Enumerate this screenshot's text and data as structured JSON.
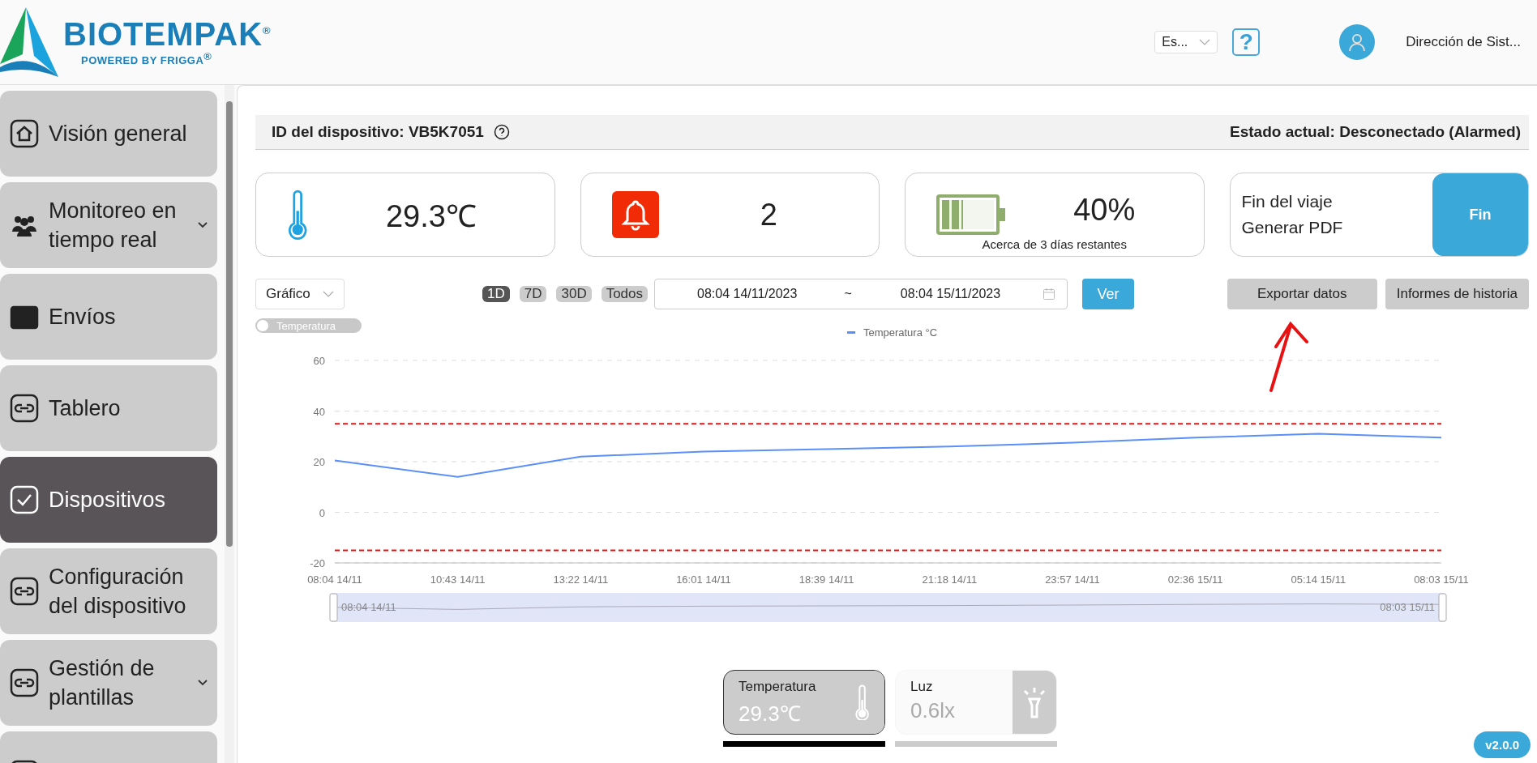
{
  "header": {
    "logo": {
      "name": "BIOTEMPAK",
      "registered": "®",
      "tagline": "POWERED BY FRIGGA",
      "tagline_registered": "®"
    },
    "language": "Es...",
    "help": "?",
    "user": "Dirección de Sist..."
  },
  "sidebar": {
    "items": [
      {
        "label": "Visión general",
        "selected": false,
        "submenu": false
      },
      {
        "label": "Monitoreo en tiempo real",
        "selected": false,
        "submenu": true
      },
      {
        "label": "Envíos",
        "selected": false,
        "submenu": false
      },
      {
        "label": "Tablero",
        "selected": false,
        "submenu": false
      },
      {
        "label": "Dispositivos",
        "selected": true,
        "submenu": false
      },
      {
        "label": "Configuración del dispositivo",
        "selected": false,
        "submenu": false
      },
      {
        "label": "Gestión de plantillas",
        "selected": false,
        "submenu": true
      },
      {
        "selected": false
      }
    ]
  },
  "device": {
    "id_label": "ID del dispositivo: VB5K7051",
    "status": "Estado actual: Desconectado (Alarmed)"
  },
  "cards": [
    {
      "kind": "temperature",
      "value": "29.3℃"
    },
    {
      "kind": "alarm",
      "value": "2"
    },
    {
      "kind": "battery",
      "value": "40%",
      "level": 0.4,
      "note": "Acerca de 3 días restantes"
    },
    {
      "kind": "trip",
      "lines": [
        "Fin del viaje",
        "Generar PDF"
      ],
      "button": "Fin"
    }
  ],
  "controls": {
    "view": "Gráfico",
    "periods": [
      {
        "label": "1D",
        "selected": true
      },
      {
        "label": "7D",
        "selected": false
      },
      {
        "label": "30D",
        "selected": false
      },
      {
        "label": "Todos",
        "selected": false
      }
    ],
    "range": {
      "start": "08:04 14/11/2023",
      "separator": "~",
      "end": "08:04 15/11/2023"
    },
    "apply": "Ver",
    "buttons": [
      "Exportar datos",
      "Informes de historia"
    ]
  },
  "toggle": {
    "label": "Temperatura",
    "on": false
  },
  "chart": {
    "chart_data": {
      "type": "line",
      "categories": [
        "08:04 14/11",
        "10:43 14/11",
        "13:22 14/11",
        "16:01 14/11",
        "18:39 14/11",
        "21:18 14/11",
        "23:57 14/11",
        "02:36 15/11",
        "05:14 15/11",
        "08:03 15/11"
      ],
      "series": [
        {
          "name": "Temperatura °C",
          "color": "#5b8ff9",
          "values": [
            20.5,
            14,
            22,
            24,
            25,
            26,
            27.5,
            29.5,
            31,
            29.5
          ]
        }
      ],
      "ylim": [
        -20,
        60
      ],
      "yticks": [
        -20,
        0,
        20,
        40,
        60
      ],
      "grid": true,
      "ref_lines": [
        {
          "axis": "y",
          "value": 35,
          "color": "#ee1111"
        },
        {
          "axis": "y",
          "value": -15,
          "color": "#ee1111"
        }
      ]
    },
    "slider": {
      "start": "08:04 14/11",
      "end": "08:03 15/11"
    }
  },
  "sensors": [
    {
      "label": "Temperatura",
      "value": "29.3℃",
      "selected": true
    },
    {
      "label": "Luz",
      "value": "0.6lx",
      "selected": false
    }
  ],
  "version": "v2.0.0"
}
